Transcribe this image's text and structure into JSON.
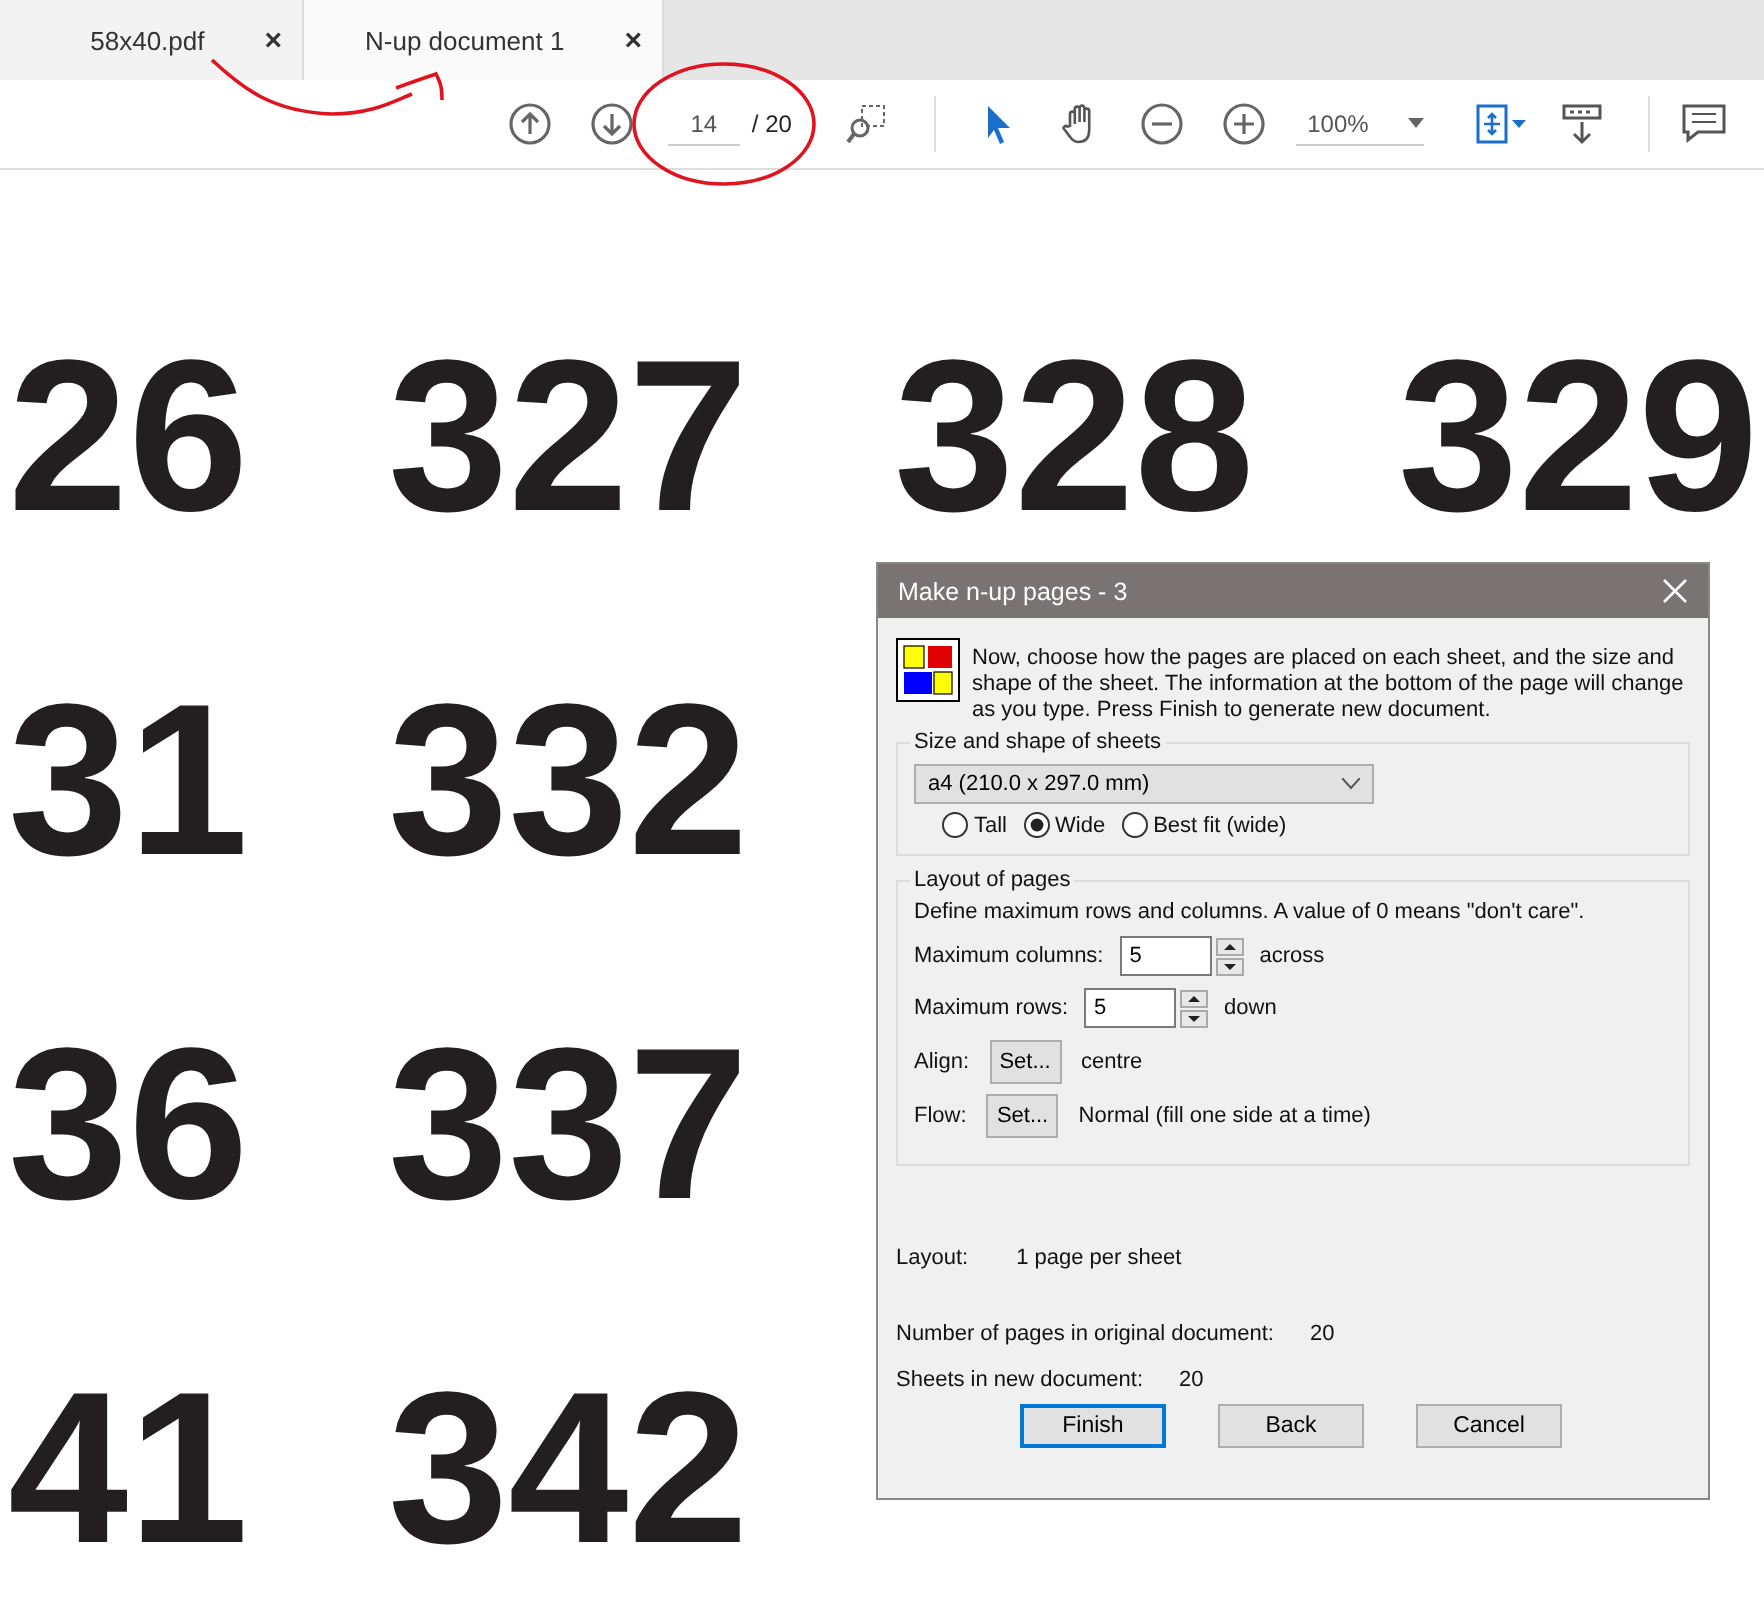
{
  "tabs": [
    {
      "label": "58x40.pdf",
      "close": "×",
      "selected": false
    },
    {
      "label": "N-up document 1",
      "close": "×",
      "selected": true
    }
  ],
  "toolbar": {
    "page_number": "14",
    "page_total": "/ 20",
    "zoom": "100%"
  },
  "document": {
    "rows": [
      {
        "cells": [
          {
            "text": "26"
          },
          {
            "text": "327"
          },
          {
            "text": "328"
          },
          {
            "text": "329"
          }
        ]
      },
      {
        "cells": [
          {
            "text": "31"
          },
          {
            "text": "332"
          }
        ]
      },
      {
        "cells": [
          {
            "text": "36"
          },
          {
            "text": "337"
          }
        ]
      },
      {
        "cells": [
          {
            "text": "41"
          },
          {
            "text": "342"
          }
        ]
      }
    ]
  },
  "dialog": {
    "title": "Make n-up pages - 3",
    "intro": "Now, choose how the pages are placed on each sheet, and the size and shape of the sheet. The information at the bottom of the page will change as you type. Press Finish to generate new document.",
    "size_group": {
      "legend": "Size and shape of sheets",
      "paper": "a4 (210.0 x 297.0 mm)",
      "orientations": [
        {
          "label": "Tall",
          "selected": false
        },
        {
          "label": "Wide",
          "selected": true
        },
        {
          "label": "Best fit (wide)",
          "selected": false
        }
      ]
    },
    "layout_group": {
      "legend": "Layout of pages",
      "hint": "Define maximum rows and columns. A value of 0 means \"don't care\".",
      "spinners": [
        {
          "label": "Maximum columns:",
          "value": "5",
          "unit": "across"
        },
        {
          "label": "Maximum rows:",
          "value": "5",
          "unit": "down"
        }
      ],
      "settings": [
        {
          "label": "Align:",
          "button": "Set...",
          "value": "centre"
        },
        {
          "label": "Flow:",
          "button": "Set...",
          "value": "Normal (fill one side at a time)"
        }
      ]
    },
    "summary": [
      {
        "label": "Layout:",
        "value": "1 page per sheet"
      },
      {
        "label": "Number of pages in original document:",
        "value": "20"
      },
      {
        "label": "Sheets in new document:",
        "value": "20"
      }
    ],
    "buttons": [
      {
        "label": "Finish",
        "default": true
      },
      {
        "label": "Back",
        "default": false
      },
      {
        "label": "Cancel",
        "default": false
      }
    ]
  }
}
